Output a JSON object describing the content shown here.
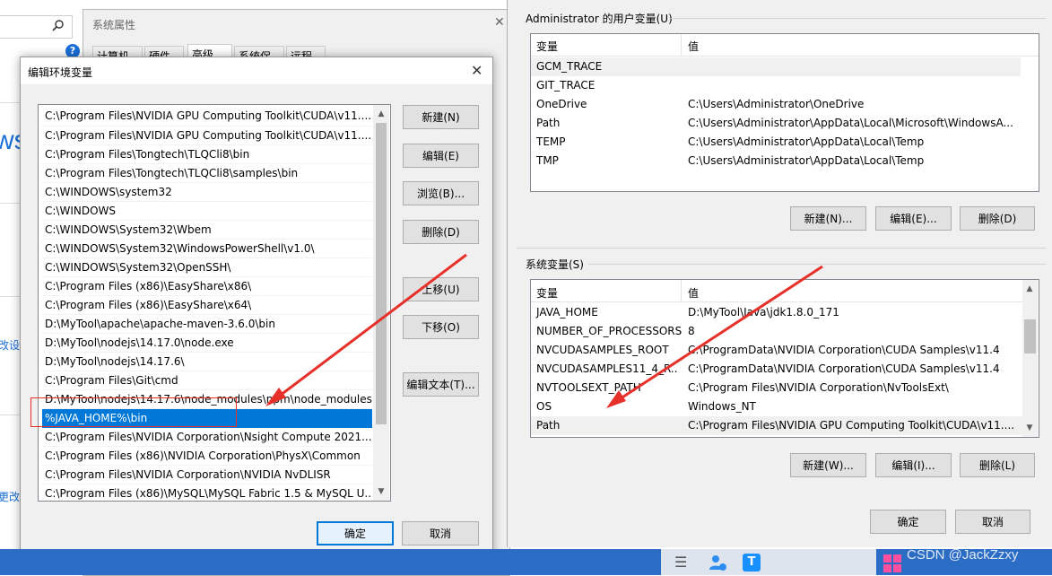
{
  "left_fragment": {
    "search_icon": "search-icon",
    "help_icon": "help-icon",
    "partial_text_1": "ws",
    "partial_text_2": "改设置",
    "partial_text_3": "更改"
  },
  "sys_props": {
    "title": "系统属性",
    "tabs": [
      "计算机名",
      "硬件",
      "高级",
      "系统保护",
      "远程"
    ]
  },
  "edit_dialog": {
    "title": "编辑环境变量",
    "items": [
      "C:\\Program Files\\NVIDIA GPU Computing Toolkit\\CUDA\\v11....",
      "C:\\Program Files\\NVIDIA GPU Computing Toolkit\\CUDA\\v11....",
      "C:\\Program Files\\Tongtech\\TLQCli8\\bin",
      "C:\\Program Files\\Tongtech\\TLQCli8\\samples\\bin",
      "C:\\WINDOWS\\system32",
      "C:\\WINDOWS",
      "C:\\WINDOWS\\System32\\Wbem",
      "C:\\WINDOWS\\System32\\WindowsPowerShell\\v1.0\\",
      "C:\\WINDOWS\\System32\\OpenSSH\\",
      "C:\\Program Files (x86)\\EasyShare\\x86\\",
      "C:\\Program Files (x86)\\EasyShare\\x64\\",
      "D:\\MyTool\\apache\\apache-maven-3.6.0\\bin",
      "D:\\MyTool\\nodejs\\14.17.0\\node.exe",
      "D:\\MyTool\\nodejs\\14.17.6\\",
      "C:\\Program Files\\Git\\cmd",
      "D:\\MyTool\\nodejs\\14.17.6\\node_modules\\npm\\node_modules",
      "%JAVA_HOME%\\bin",
      "C:\\Program Files\\NVIDIA Corporation\\Nsight Compute 2021....",
      "C:\\Program Files (x86)\\NVIDIA Corporation\\PhysX\\Common",
      "C:\\Program Files\\NVIDIA Corporation\\NVIDIA NvDLISR",
      "C:\\Program Files (x86)\\MySQL\\MySQL Fabric 1.5 & MySQL U..."
    ],
    "selected_index": 16,
    "buttons": {
      "new": "新建(N)",
      "edit": "编辑(E)",
      "browse": "浏览(B)...",
      "delete": "删除(D)",
      "move_up": "上移(U)",
      "move_down": "下移(O)",
      "edit_text": "编辑文本(T)...",
      "ok": "确定",
      "cancel": "取消"
    }
  },
  "env_vars": {
    "user_group_label": "Administrator 的用户变量(U)",
    "columns": [
      "变量",
      "值"
    ],
    "user_vars": [
      {
        "name": "GCM_TRACE",
        "value": ""
      },
      {
        "name": "GIT_TRACE",
        "value": ""
      },
      {
        "name": "OneDrive",
        "value": "C:\\Users\\Administrator\\OneDrive"
      },
      {
        "name": "Path",
        "value": "C:\\Users\\Administrator\\AppData\\Local\\Microsoft\\WindowsA..."
      },
      {
        "name": "TEMP",
        "value": "C:\\Users\\Administrator\\AppData\\Local\\Temp"
      },
      {
        "name": "TMP",
        "value": "C:\\Users\\Administrator\\AppData\\Local\\Temp"
      }
    ],
    "user_buttons": {
      "new": "新建(N)...",
      "edit": "编辑(E)...",
      "delete": "删除(D)"
    },
    "sys_group_label": "系统变量(S)",
    "sys_vars": [
      {
        "name": "JAVA_HOME",
        "value": "D:\\MyTool\\Java\\jdk1.8.0_171"
      },
      {
        "name": "NUMBER_OF_PROCESSORS",
        "value": "8"
      },
      {
        "name": "NVCUDASAMPLES_ROOT",
        "value": "C:\\ProgramData\\NVIDIA Corporation\\CUDA Samples\\v11.4"
      },
      {
        "name": "NVCUDASAMPLES11_4_R...",
        "value": "C:\\ProgramData\\NVIDIA Corporation\\CUDA Samples\\v11.4"
      },
      {
        "name": "NVTOOLSEXT_PATH",
        "value": "C:\\Program Files\\NVIDIA Corporation\\NvToolsExt\\"
      },
      {
        "name": "OS",
        "value": "Windows_NT"
      },
      {
        "name": "Path",
        "value": "C:\\Program Files\\NVIDIA GPU Computing Toolkit\\CUDA\\v11...."
      }
    ],
    "sys_buttons": {
      "new": "新建(W)...",
      "edit": "编辑(I)...",
      "delete": "删除(L)"
    },
    "ok": "确定",
    "cancel": "取消"
  },
  "watermark": "CSDN @JackZzxy",
  "annotation_color": "#e8302a",
  "selection_color": "#0078d7"
}
